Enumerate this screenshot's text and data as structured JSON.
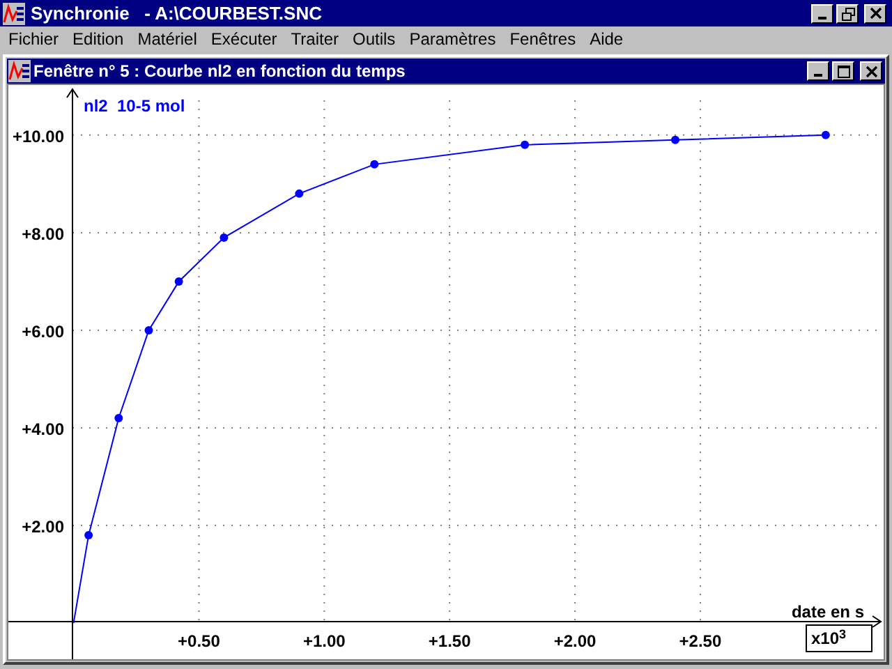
{
  "window": {
    "title": "Synchronie   - A:\\COURBEST.SNC"
  },
  "menu": [
    "Fichier",
    "Edition",
    "Matériel",
    "Exécuter",
    "Traiter",
    "Outils",
    "Paramètres",
    "Fenêtres",
    "Aide"
  ],
  "child_window": {
    "title": "Fenêtre n° 5 : Courbe nl2 en fonction du temps",
    "plot": {
      "multiplier": "x10$^{3}$",
      "chart_data": {
        "type": "line",
        "xlabel": "date en s",
        "ylabel": "nl2  10-5 mol",
        "x": [
          0,
          0.06,
          0.18,
          0.3,
          0.42,
          0.6,
          0.9,
          1.2,
          1.8,
          2.4,
          3.0
        ],
        "xlim": [
          -0.26,
          3.22
        ],
        "ylim": [
          -0.74,
          10.94
        ],
        "grid": true,
        "series": [
          {
            "color": "#0000ff",
            "marker": "circle",
            "values": [
              0,
              1.8,
              4.2,
              6.0,
              7.0,
              7.9,
              8.8,
              9.4,
              9.8,
              9.9,
              10.0
            ]
          }
        ],
        "xticks": [
          {
            "value": 0.5,
            "label": "+0.50"
          },
          {
            "value": 1.0,
            "label": "+1.00"
          },
          {
            "value": 1.5,
            "label": "+1.50"
          },
          {
            "value": 2.0,
            "label": "+2.00"
          },
          {
            "value": 2.5,
            "label": "+2.50"
          }
        ],
        "yticks": [
          {
            "value": 2,
            "label": "+2.00"
          },
          {
            "value": 4,
            "label": "+4.00"
          },
          {
            "value": 6,
            "label": "+6.00"
          },
          {
            "value": 8,
            "label": "+8.00"
          },
          {
            "value": 10,
            "label": "+10.00"
          }
        ]
      }
    }
  }
}
